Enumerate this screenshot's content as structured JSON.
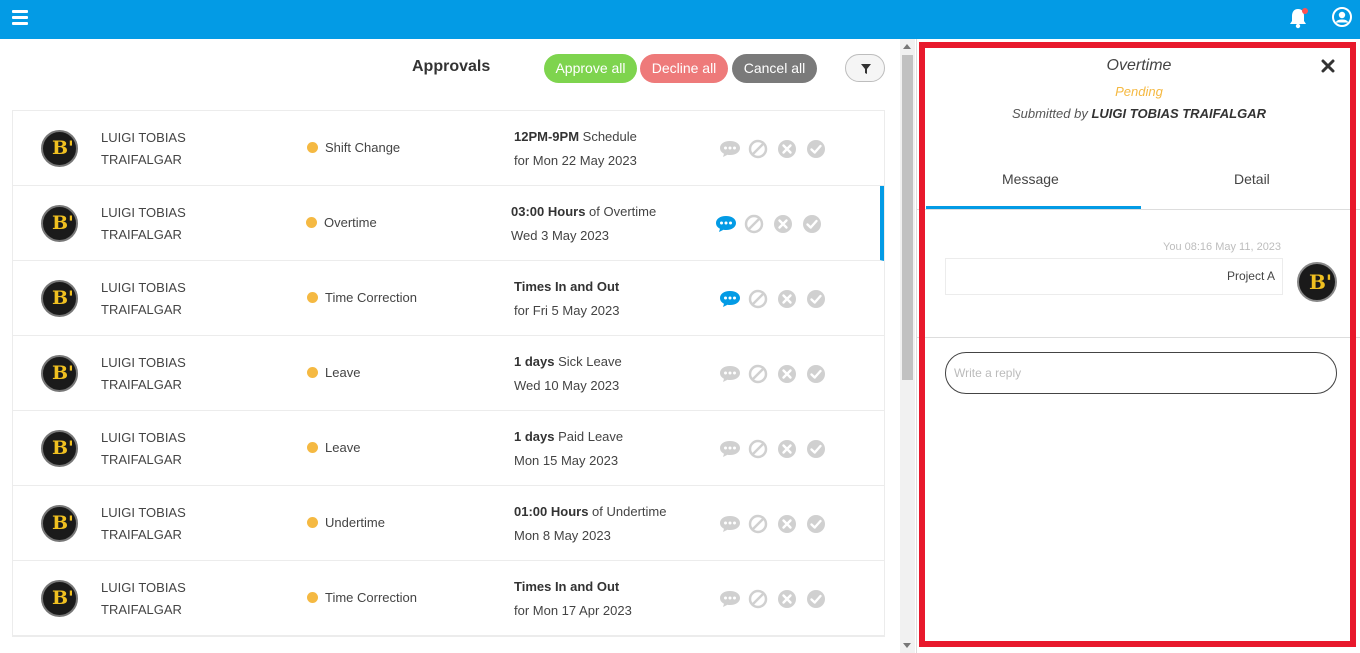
{
  "topbar": {
    "menu_icon": "hamburger-icon",
    "bell_icon": "bell-icon",
    "user_icon": "user-circle-icon",
    "notification_dot_color": "#ff5252"
  },
  "header": {
    "title": "Approvals",
    "approve_all": "Approve all",
    "decline_all": "Decline all",
    "cancel_all": "Cancel all",
    "filter_icon": "filter-icon"
  },
  "colors": {
    "brand": "#039be5",
    "approve": "#7ed44e",
    "decline": "#ee7a7a",
    "cancel": "#7a7a7a",
    "pending": "#f5b942",
    "highlight_frame": "#e8192c"
  },
  "rows": [
    {
      "name_line1": "LUIGI TOBIAS",
      "name_line2": "TRAIFALGAR",
      "type": "Shift Change",
      "detail_bold": "12PM-9PM",
      "detail_rest": " Schedule",
      "detail_date": "for Mon 22 May 2023",
      "has_message": false
    },
    {
      "name_line1": "LUIGI TOBIAS",
      "name_line2": "TRAIFALGAR",
      "type": "Overtime",
      "detail_bold": "03:00 Hours",
      "detail_rest": " of Overtime",
      "detail_date": "Wed 3 May 2023",
      "has_message": true
    },
    {
      "name_line1": "LUIGI TOBIAS",
      "name_line2": "TRAIFALGAR",
      "type": "Time Correction",
      "detail_bold": "Times In and Out",
      "detail_rest": "",
      "detail_date": "for Fri 5 May 2023",
      "has_message": true
    },
    {
      "name_line1": "LUIGI TOBIAS",
      "name_line2": "TRAIFALGAR",
      "type": "Leave",
      "detail_bold": "1 days",
      "detail_rest": " Sick Leave",
      "detail_date": "Wed 10 May 2023",
      "has_message": false
    },
    {
      "name_line1": "LUIGI TOBIAS",
      "name_line2": "TRAIFALGAR",
      "type": "Leave",
      "detail_bold": "1 days",
      "detail_rest": " Paid Leave",
      "detail_date": "Mon 15 May 2023",
      "has_message": false
    },
    {
      "name_line1": "LUIGI TOBIAS",
      "name_line2": "TRAIFALGAR",
      "type": "Undertime",
      "detail_bold": "01:00 Hours",
      "detail_rest": " of Undertime",
      "detail_date": "Mon 8 May 2023",
      "has_message": false
    },
    {
      "name_line1": "LUIGI TOBIAS",
      "name_line2": "TRAIFALGAR",
      "type": "Time Correction",
      "detail_bold": "Times In and Out",
      "detail_rest": "",
      "detail_date": "for Mon 17 Apr 2023",
      "has_message": false
    }
  ],
  "avatar_text": "B'",
  "panel": {
    "title": "Overtime",
    "status": "Pending",
    "submitted_prefix": "Submitted by ",
    "submitted_by": "LUIGI TOBIAS TRAIFALGAR",
    "tabs": {
      "message": "Message",
      "detail": "Detail"
    },
    "message": {
      "meta": "You 08:16 May 11, 2023",
      "text": "Project A"
    },
    "reply_placeholder": "Write a reply",
    "close_icon": "close-icon"
  }
}
